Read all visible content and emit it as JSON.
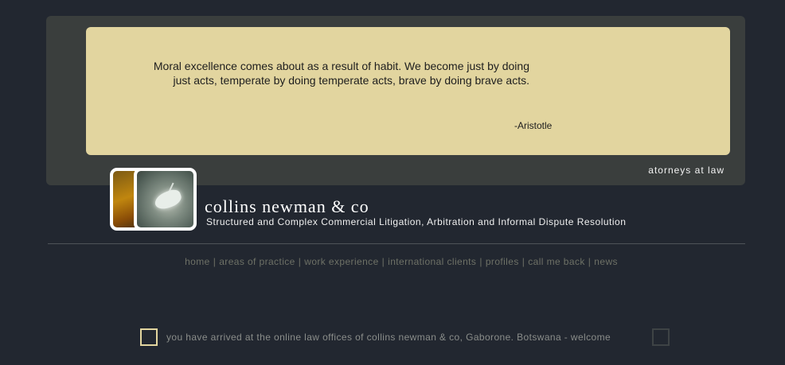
{
  "quote": {
    "line1": "Moral excellence comes about as a result of habit. We become just by doing",
    "line2": "just acts, temperate by doing temperate acts, brave by doing brave acts.",
    "author": "-Aristotle"
  },
  "tagline": "atorneys at law",
  "firm": {
    "name": "collins newman & co",
    "description": "Structured and Complex Commercial Litigation, Arbitration and Informal Dispute Resolution"
  },
  "nav": {
    "items": [
      {
        "label": "home"
      },
      {
        "label": "areas of practice"
      },
      {
        "label": "work experience"
      },
      {
        "label": "international clients"
      },
      {
        "label": "profiles"
      },
      {
        "label": "call me back"
      },
      {
        "label": "news"
      }
    ],
    "separator": "|"
  },
  "welcome": "you have arrived at the online law offices of collins newman & co, Gaborone. Botswana - welcome",
  "colors": {
    "background": "#222730",
    "panel": "#3a3e3d",
    "quote_box": "#e2d59f",
    "nav_text": "#6e7166"
  }
}
